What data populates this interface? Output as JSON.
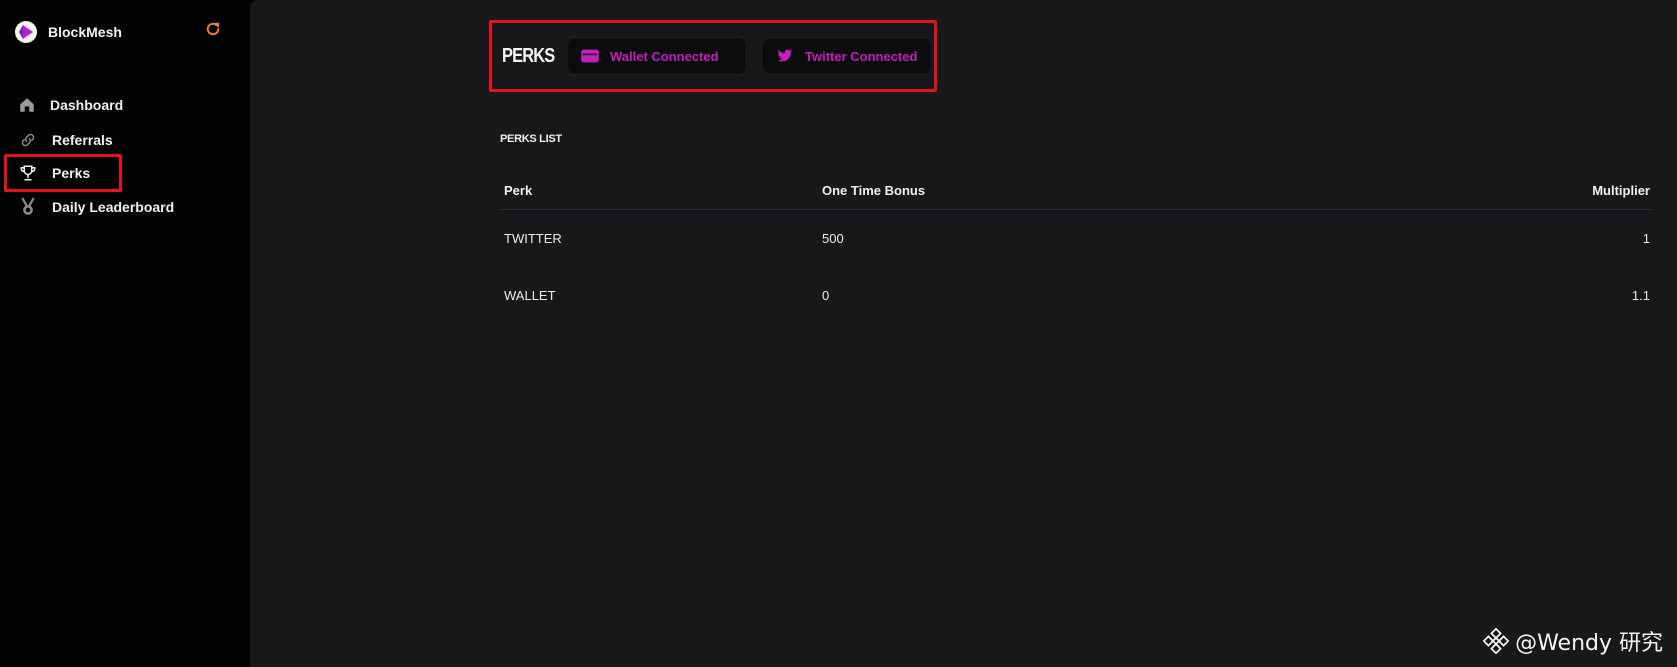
{
  "app": {
    "name": "BlockMesh"
  },
  "sidebar": {
    "items": [
      {
        "label": "Dashboard",
        "icon": "home-icon",
        "active": false
      },
      {
        "label": "Referrals",
        "icon": "link-icon",
        "active": false
      },
      {
        "label": "Perks",
        "icon": "trophy-icon",
        "active": true
      },
      {
        "label": "Daily Leaderboard",
        "icon": "medal-icon",
        "active": false
      }
    ]
  },
  "header": {
    "title": "PERKS",
    "badges": {
      "wallet": {
        "label": "Wallet Connected",
        "icon": "wallet-icon"
      },
      "twitter": {
        "label": "Twitter Connected",
        "icon": "twitter-bird-icon"
      }
    }
  },
  "perks_list": {
    "title": "PERKS LIST",
    "columns": {
      "perk": "Perk",
      "bonus": "One Time Bonus",
      "multiplier": "Multiplier"
    },
    "rows": [
      {
        "perk": "TWITTER",
        "bonus": "500",
        "multiplier": "1"
      },
      {
        "perk": "WALLET",
        "bonus": "0",
        "multiplier": "1.1"
      }
    ]
  },
  "watermark": {
    "text": "@Wendy 研究"
  },
  "colors": {
    "accent": "#c21fbd",
    "highlight": "#e5141c",
    "refresh": "#e8843a",
    "sidebar_bg": "#030303",
    "main_bg": "#18181b"
  }
}
